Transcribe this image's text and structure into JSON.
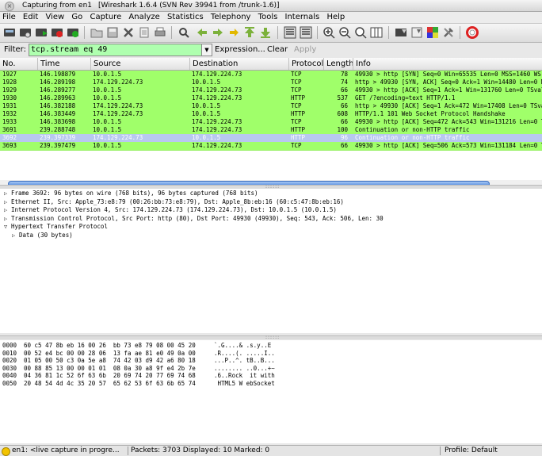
{
  "window": {
    "title": "Capturing from en1",
    "subtitle": "[Wireshark 1.6.4  (SVN Rev 39941 from /trunk-1.6)]"
  },
  "menu": [
    "File",
    "Edit",
    "View",
    "Go",
    "Capture",
    "Analyze",
    "Statistics",
    "Telephony",
    "Tools",
    "Internals",
    "Help"
  ],
  "toolbar": {
    "icons": [
      "interfaces-icon",
      "options-icon",
      "start-icon",
      "stop-icon",
      "restart-icon",
      "open-icon",
      "save-icon",
      "close-icon",
      "reload-icon",
      "print-icon",
      "find-icon",
      "back-icon",
      "forward-icon",
      "goto-icon",
      "first-icon",
      "last-icon",
      "colorize-icon",
      "autoscroll-icon",
      "zoom-in-icon",
      "zoom-out-icon",
      "normal-size-icon",
      "resize-columns-icon",
      "capture-filters-icon",
      "display-filters-icon",
      "coloring-rules-icon",
      "preferences-icon",
      "help-icon"
    ]
  },
  "filter": {
    "label": "Filter:",
    "value": "tcp.stream eq 49",
    "expression_label": "Expression...",
    "clear_label": "Clear",
    "apply_label": "Apply"
  },
  "packet_list": {
    "columns": [
      "No.",
      "Time",
      "Source",
      "Destination",
      "Protocol",
      "Length",
      "Info"
    ],
    "rows": [
      {
        "no": "1927",
        "time": "146.198879",
        "src": "10.0.1.5",
        "dst": "174.129.224.73",
        "proto": "TCP",
        "len": "78",
        "info": "49930 > http [SYN] Seq=0 Win=65535 Len=0 MSS=1460 WS",
        "bg": "#a0ff6a",
        "fg": "#000000"
      },
      {
        "no": "1928",
        "time": "146.289198",
        "src": "174.129.224.73",
        "dst": "10.0.1.5",
        "proto": "TCP",
        "len": "74",
        "info": "http > 49930 [SYN, ACK] Seq=0 Ack=1 Win=14480 Len=0 MS",
        "bg": "#a0ff6a",
        "fg": "#000000"
      },
      {
        "no": "1929",
        "time": "146.289277",
        "src": "10.0.1.5",
        "dst": "174.129.224.73",
        "proto": "TCP",
        "len": "66",
        "info": "49930 > http [ACK] Seq=1 Ack=1 Win=131760 Len=0 TSval",
        "bg": "#a0ff6a",
        "fg": "#000000"
      },
      {
        "no": "1930",
        "time": "146.289963",
        "src": "10.0.1.5",
        "dst": "174.129.224.73",
        "proto": "HTTP",
        "len": "537",
        "info": "GET /?encoding=text HTTP/1.1",
        "bg": "#a0ff6a",
        "fg": "#000000"
      },
      {
        "no": "1931",
        "time": "146.382188",
        "src": "174.129.224.73",
        "dst": "10.0.1.5",
        "proto": "TCP",
        "len": "66",
        "info": "http > 49930 [ACK] Seq=1 Ack=472 Win=17408 Len=0 TSva",
        "bg": "#a0ff6a",
        "fg": "#000000"
      },
      {
        "no": "1932",
        "time": "146.383449",
        "src": "174.129.224.73",
        "dst": "10.0.1.5",
        "proto": "HTTP",
        "len": "608",
        "info": "HTTP/1.1 101 Web Socket Protocol Handshake",
        "bg": "#a0ff6a",
        "fg": "#000000"
      },
      {
        "no": "1933",
        "time": "146.383698",
        "src": "10.0.1.5",
        "dst": "174.129.224.73",
        "proto": "TCP",
        "len": "66",
        "info": "49930 > http [ACK] Seq=472 Ack=543 Win=131216 Len=0 TS",
        "bg": "#a0ff6a",
        "fg": "#000000"
      },
      {
        "no": "3691",
        "time": "239.288748",
        "src": "10.0.1.5",
        "dst": "174.129.224.73",
        "proto": "HTTP",
        "len": "100",
        "info": "Continuation or non-HTTP traffic",
        "bg": "#a0ff6a",
        "fg": "#000000"
      },
      {
        "no": "3692",
        "time": "239.397339",
        "src": "174.129.224.73",
        "dst": "10.0.1.5",
        "proto": "HTTP",
        "len": "96",
        "info": "Continuation or non-HTTP traffic",
        "bg": "#b8c8f0",
        "fg": "#ffffff"
      },
      {
        "no": "3693",
        "time": "239.397479",
        "src": "10.0.1.5",
        "dst": "174.129.224.73",
        "proto": "TCP",
        "len": "66",
        "info": "49930 > http [ACK] Seq=506 Ack=573 Win=131184 Len=0 TS",
        "bg": "#a0ff6a",
        "fg": "#000000"
      }
    ]
  },
  "details": [
    {
      "text": "Frame 3692: 96 bytes on wire (768 bits), 96 bytes captured (768 bits)",
      "expanded": false,
      "indent": 0
    },
    {
      "text": "Ethernet II, Src: Apple_73:e8:79 (00:26:bb:73:e8:79), Dst: Apple_8b:eb:16 (60:c5:47:8b:eb:16)",
      "expanded": false,
      "indent": 0
    },
    {
      "text": "Internet Protocol Version 4, Src: 174.129.224.73 (174.129.224.73), Dst: 10.0.1.5 (10.0.1.5)",
      "expanded": false,
      "indent": 0
    },
    {
      "text": "Transmission Control Protocol, Src Port: http (80), Dst Port: 49930 (49930), Seq: 543, Ack: 506, Len: 30",
      "expanded": false,
      "indent": 0
    },
    {
      "text": "Hypertext Transfer Protocol",
      "expanded": true,
      "indent": 0
    },
    {
      "text": "Data (30 bytes)",
      "expanded": false,
      "indent": 1
    }
  ],
  "bytes": [
    {
      "offset": "0000",
      "hex": "60 c5 47 8b eb 16 00 26  bb 73 e8 79 08 00 45 20",
      "ascii": "`.G....& .s.y..E "
    },
    {
      "offset": "0010",
      "hex": "00 52 e4 bc 00 00 28 06  13 fa ae 81 e0 49 0a 00",
      "ascii": ".R....(. .....I.."
    },
    {
      "offset": "0020",
      "hex": "01 05 00 50 c3 0a 5e a8  74 42 03 d9 42 a6 80 18",
      "ascii": "...P..^. tB..B..."
    },
    {
      "offset": "0030",
      "hex": "00 88 85 13 00 00 01 01  08 0a 30 a8 9f e4 2b 7e",
      "ascii": "........ ..0...+~"
    },
    {
      "offset": "0040",
      "hex": "04 36 81 1c 52 6f 63 6b  20 69 74 20 77 69 74 68",
      "ascii": ".6..Rock  it with"
    },
    {
      "offset": "0050",
      "hex": "20 48 54 4d 4c 35 20 57  65 62 53 6f 63 6b 65 74",
      "ascii": " HTML5 W ebSocket"
    }
  ],
  "status": {
    "capture": "en1: <live capture in progre...",
    "counts": "Packets: 3703 Displayed: 10 Marked: 0",
    "profile": "Profile: Default"
  }
}
